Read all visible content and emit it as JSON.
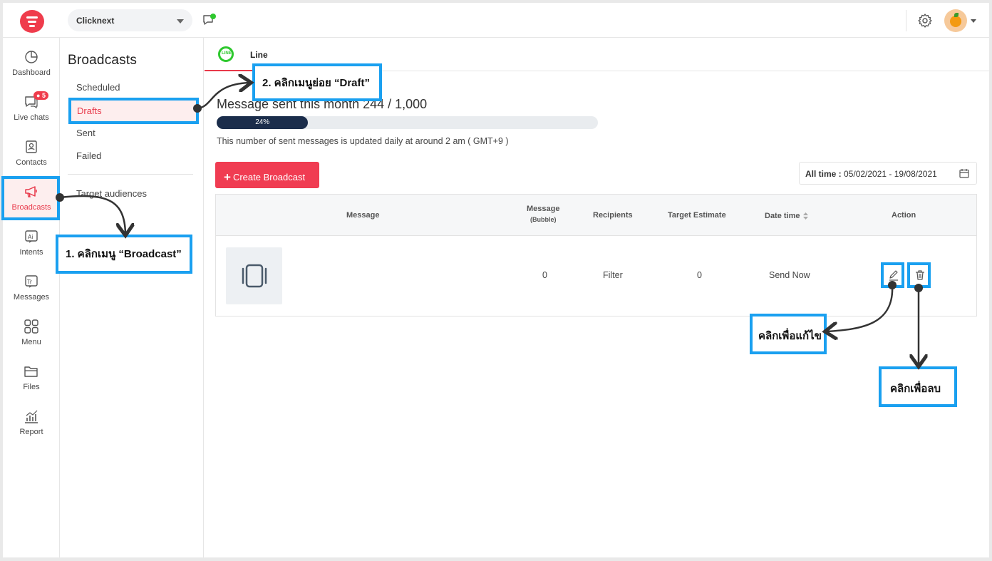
{
  "header": {
    "workspace": "Clicknext"
  },
  "nav": {
    "items": [
      {
        "label": "Dashboard"
      },
      {
        "label": "Live chats",
        "badge": "5"
      },
      {
        "label": "Contacts"
      },
      {
        "label": "Broadcasts"
      },
      {
        "label": "Intents"
      },
      {
        "label": "Messages"
      },
      {
        "label": "Menu"
      },
      {
        "label": "Files"
      },
      {
        "label": "Report"
      }
    ]
  },
  "subnav": {
    "title": "Broadcasts",
    "items": [
      "Scheduled",
      "Drafts",
      "Sent",
      "Failed"
    ],
    "target": "Target audiences"
  },
  "tab": {
    "icon_text": "LINE",
    "label": "Line"
  },
  "usage": {
    "title": "Message sent this month 244 / 1,000",
    "percent_label": "24%",
    "percent": 24,
    "note": "This number of sent messages is updated daily at around 2 am ( GMT+9 )"
  },
  "toolbar": {
    "create_label": "Create Broadcast",
    "date_label": "All time :",
    "date_range": "05/02/2021 - 19/08/2021"
  },
  "table": {
    "headers": {
      "message": "Message",
      "bubble_top": "Message",
      "bubble_sub": "(Bubble)",
      "recipients": "Recipients",
      "target": "Target Estimate",
      "date": "Date time",
      "action": "Action"
    },
    "row": {
      "bubble": "0",
      "recipients": "Filter",
      "target": "0",
      "date": "Send Now"
    }
  },
  "annotations": {
    "step1": "1. คลิกเมนู “Broadcast”",
    "step2": "2. คลิกเมนูย่อย “Draft”",
    "edit": "คลิกเพื่อแก้ไข",
    "delete": "คลิกเพื่อลบ"
  },
  "colors": {
    "accent": "#e8394a",
    "highlight": "#1aa0f0",
    "progress": "#1b2d4b",
    "line_green": "#2ec82e"
  }
}
